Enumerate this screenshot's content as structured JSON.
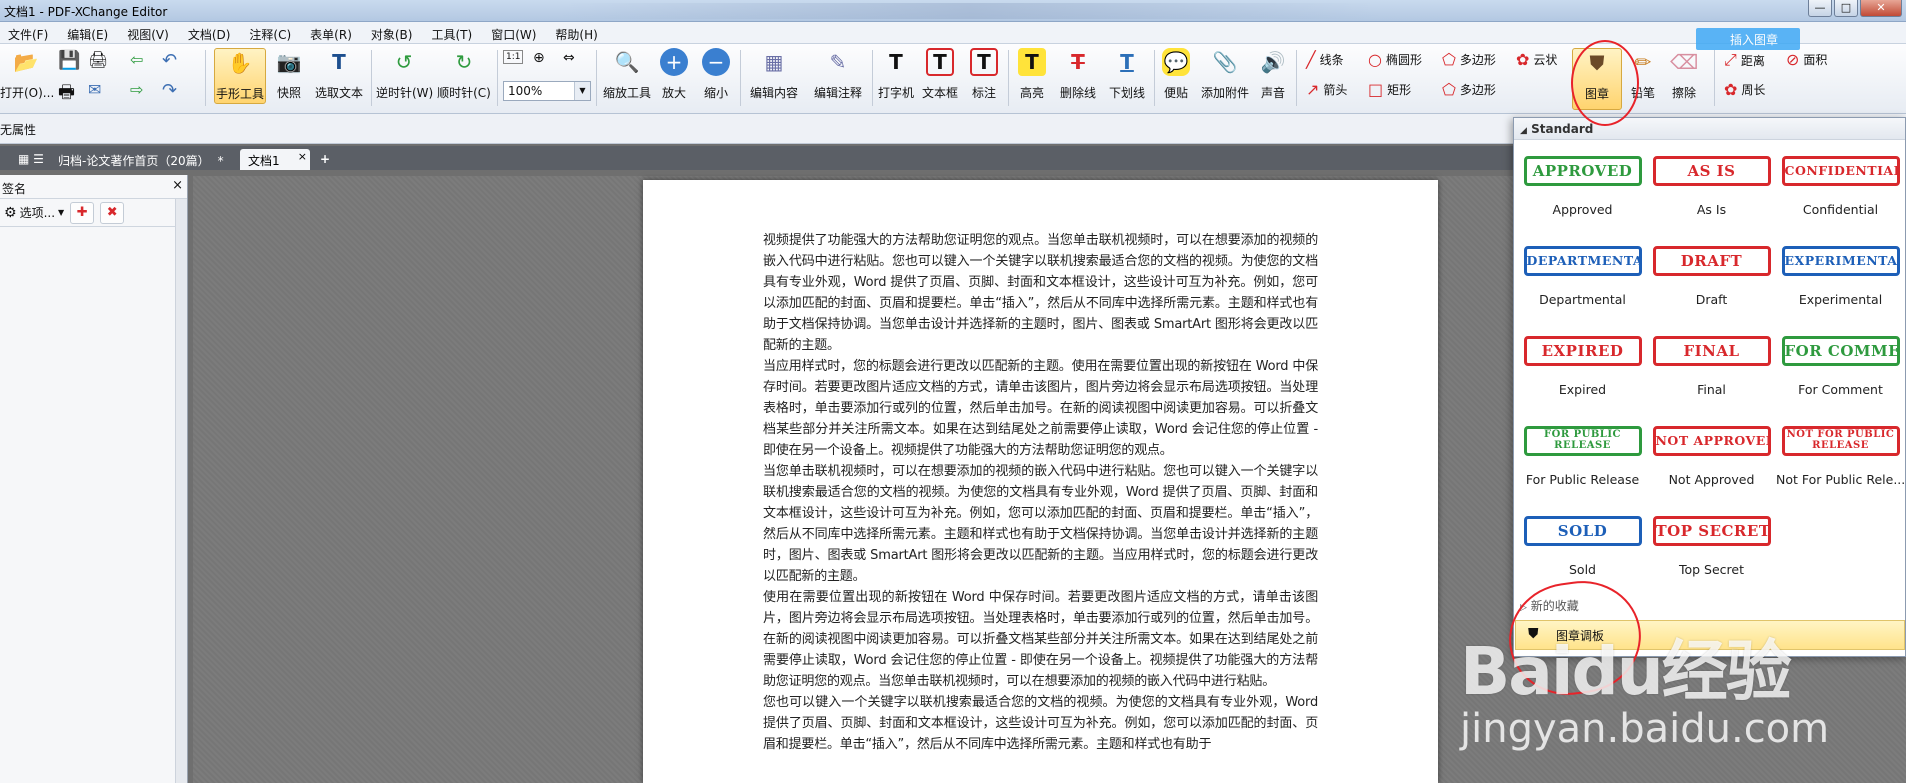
{
  "window": {
    "title": "文档1 - PDF-XChange Editor",
    "controls": [
      "—",
      "□",
      "✕"
    ]
  },
  "menu": [
    "文件(F)",
    "编辑(E)",
    "视图(V)",
    "文档(D)",
    "注释(C)",
    "表单(R)",
    "对象(B)",
    "工具(T)",
    "窗口(W)",
    "帮助(H)"
  ],
  "toolbar": {
    "open": "打开(O)...",
    "hand": "手形工具",
    "snapshot": "快照",
    "select_text": "选取文本",
    "rotate_ccw": "逆时针(W)",
    "rotate_cw": "顺时针(C)",
    "zoom_value": "100%",
    "zoom_tool": "缩放工具",
    "zoom_in": "放大",
    "zoom_out": "缩小",
    "edit_content": "编辑内容",
    "edit_comment": "编辑注释",
    "typewriter": "打字机",
    "textbox": "文本框",
    "callout": "标注",
    "highlight": "高亮",
    "strikeout": "删除线",
    "underline": "下划线",
    "sticky": "便贴",
    "attach": "添加附件",
    "sound": "声音",
    "line": "线条",
    "ellipse": "椭圆形",
    "polygon": "多边形",
    "cloud": "云状",
    "arrow": "箭头",
    "rect": "矩形",
    "polygon2": "多边形",
    "stamp": "图章",
    "pencil": "铅笔",
    "eraser": "擦除",
    "distance": "距离",
    "area": "面积",
    "perimeter": "周长"
  },
  "properties": {
    "label": "无属性"
  },
  "tabs": [
    {
      "label": "归档-论文著作首页（20篇）",
      "modified": "*"
    },
    {
      "label": "文档1",
      "close": "×"
    }
  ],
  "tab_add": "+",
  "sidepanel": {
    "title": "签名",
    "close": "×",
    "options": "选项..."
  },
  "document": {
    "paragraphs": [
      "视频提供了功能强大的方法帮助您证明您的观点。当您单击联机视频时，可以在想要添加的视频的嵌入代码中进行粘贴。您也可以键入一个关键字以联机搜索最适合您的文档的视频。为使您的文档具有专业外观，Word 提供了页眉、页脚、封面和文本框设计，这些设计可互为补充。例如，您可以添加匹配的封面、页眉和提要栏。单击“插入”，然后从不同库中选择所需元素。主题和样式也有助于文档保持协调。当您单击设计并选择新的主题时，图片、图表或 SmartArt 图形将会更改以匹配新的主题。",
      "当应用样式时，您的标题会进行更改以匹配新的主题。使用在需要位置出现的新按钮在 Word 中保存时间。若要更改图片适应文档的方式，请单击该图片，图片旁边将会显示布局选项按钮。当处理表格时，单击要添加行或列的位置，然后单击加号。在新的阅读视图中阅读更加容易。可以折叠文档某些部分并关注所需文本。如果在达到结尾处之前需要停止读取，Word 会记住您的停止位置 - 即使在另一个设备上。视频提供了功能强大的方法帮助您证明您的观点。",
      "当您单击联机视频时，可以在想要添加的视频的嵌入代码中进行粘贴。您也可以键入一个关键字以联机搜索最适合您的文档的视频。为使您的文档具有专业外观，Word 提供了页眉、页脚、封面和文本框设计，这些设计可互为补充。例如，您可以添加匹配的封面、页眉和提要栏。单击“插入”，然后从不同库中选择所需元素。主题和样式也有助于文档保持协调。当您单击设计并选择新的主题时，图片、图表或 SmartArt 图形将会更改以匹配新的主题。当应用样式时，您的标题会进行更改以匹配新的主题。",
      "使用在需要位置出现的新按钮在 Word 中保存时间。若要更改图片适应文档的方式，请单击该图片，图片旁边将会显示布局选项按钮。当处理表格时，单击要添加行或列的位置，然后单击加号。在新的阅读视图中阅读更加容易。可以折叠文档某些部分并关注所需文本。如果在达到结尾处之前需要停止读取，Word 会记住您的停止位置 - 即使在另一个设备上。视频提供了功能强大的方法帮助您证明您的观点。当您单击联机视频时，可以在想要添加的视频的嵌入代码中进行粘贴。",
      "您也可以键入一个关键字以联机搜索最适合您的文档的视频。为使您的文档具有专业外观，Word 提供了页眉、页脚、封面和文本框设计，这些设计可互为补充。例如，您可以添加匹配的封面、页眉和提要栏。单击“插入”，然后从不同库中选择所需元素。主题和样式也有助于"
    ]
  },
  "stamps": {
    "category": "Standard",
    "items": [
      {
        "stamp": "APPROVED",
        "caption": "Approved",
        "color": "#2e9a3e"
      },
      {
        "stamp": "AS IS",
        "caption": "As Is",
        "color": "#d8282c"
      },
      {
        "stamp": "CONFIDENTIAL",
        "caption": "Confidential",
        "color": "#d8282c"
      },
      {
        "stamp": "DEPARTMENTAL",
        "caption": "Departmental",
        "color": "#1d5fb8"
      },
      {
        "stamp": "DRAFT",
        "caption": "Draft",
        "color": "#d8282c"
      },
      {
        "stamp": "EXPERIMENTAL",
        "caption": "Experimental",
        "color": "#1d5fb8"
      },
      {
        "stamp": "EXPIRED",
        "caption": "Expired",
        "color": "#d8282c"
      },
      {
        "stamp": "FINAL",
        "caption": "Final",
        "color": "#d8282c"
      },
      {
        "stamp": "FOR COMMENT",
        "caption": "For Comment",
        "color": "#2e9a3e"
      },
      {
        "stamp": "FOR PUBLIC RELEASE",
        "caption": "For Public Release",
        "color": "#2e9a3e"
      },
      {
        "stamp": "NOT APPROVED",
        "caption": "Not Approved",
        "color": "#d8282c"
      },
      {
        "stamp": "NOT FOR PUBLIC RELEASE",
        "caption": "Not For Public Rele...",
        "color": "#d8282c"
      },
      {
        "stamp": "SOLD",
        "caption": "Sold",
        "color": "#1d5fb8"
      },
      {
        "stamp": "TOP SECRET",
        "caption": "Top Secret",
        "color": "#d8282c"
      }
    ],
    "new_favorites": "新的收藏",
    "palette": "图章调板"
  },
  "watermark": {
    "logo": "Baidu经验",
    "url": "jingyan.baidu.com"
  },
  "tooltip": "插入图章"
}
